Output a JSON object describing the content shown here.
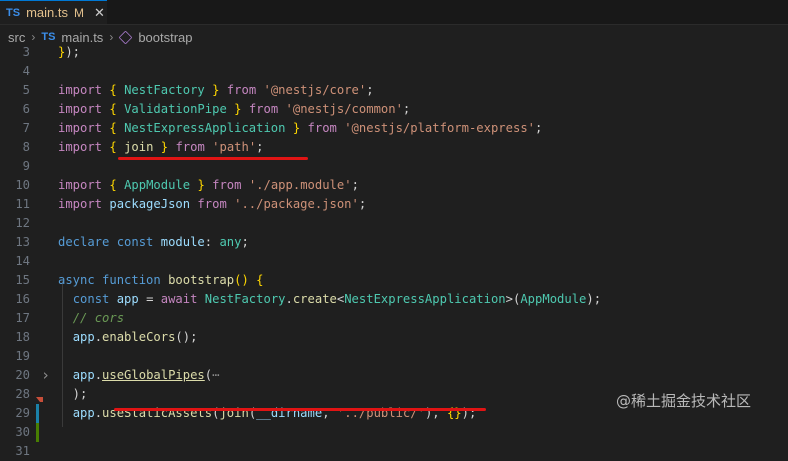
{
  "tab": {
    "icon": "TS",
    "name": "main.ts",
    "status": "M",
    "close": "✕"
  },
  "breadcrumb": {
    "folder": "src",
    "file_icon": "TS",
    "file": "main.ts",
    "symbol": "bootstrap"
  },
  "lines": [
    {
      "n": "3",
      "segs": [
        [
          "br",
          "}"
        ],
        [
          "pl",
          ");"
        ]
      ]
    },
    {
      "n": "4",
      "segs": []
    },
    {
      "n": "5",
      "segs": [
        [
          "kw2",
          "import "
        ],
        [
          "br",
          "{ "
        ],
        [
          "cls",
          "NestFactory"
        ],
        [
          "br",
          " }"
        ],
        [
          "kw2",
          " from "
        ],
        [
          "str",
          "'@nestjs/core'"
        ],
        [
          "pl",
          ";"
        ]
      ]
    },
    {
      "n": "6",
      "segs": [
        [
          "kw2",
          "import "
        ],
        [
          "br",
          "{ "
        ],
        [
          "cls",
          "ValidationPipe"
        ],
        [
          "br",
          " }"
        ],
        [
          "kw2",
          " from "
        ],
        [
          "str",
          "'@nestjs/common'"
        ],
        [
          "pl",
          ";"
        ]
      ]
    },
    {
      "n": "7",
      "segs": [
        [
          "kw2",
          "import "
        ],
        [
          "br",
          "{ "
        ],
        [
          "cls",
          "NestExpressApplication"
        ],
        [
          "br",
          " }"
        ],
        [
          "kw2",
          " from "
        ],
        [
          "str",
          "'@nestjs/platform-express'"
        ],
        [
          "pl",
          ";"
        ]
      ]
    },
    {
      "n": "8",
      "segs": [
        [
          "kw2",
          "import "
        ],
        [
          "br",
          "{ "
        ],
        [
          "fn",
          "join"
        ],
        [
          "br",
          " }"
        ],
        [
          "kw2",
          " from "
        ],
        [
          "str",
          "'path'"
        ],
        [
          "pl",
          ";"
        ]
      ]
    },
    {
      "n": "9",
      "segs": []
    },
    {
      "n": "10",
      "segs": [
        [
          "kw2",
          "import "
        ],
        [
          "br",
          "{ "
        ],
        [
          "cls",
          "AppModule"
        ],
        [
          "br",
          " }"
        ],
        [
          "kw2",
          " from "
        ],
        [
          "str",
          "'./app.module'"
        ],
        [
          "pl",
          ";"
        ]
      ]
    },
    {
      "n": "11",
      "segs": [
        [
          "kw2",
          "import "
        ],
        [
          "var",
          "packageJson"
        ],
        [
          "kw2",
          " from "
        ],
        [
          "str",
          "'../package.json'"
        ],
        [
          "pl",
          ";"
        ]
      ]
    },
    {
      "n": "12",
      "segs": []
    },
    {
      "n": "13",
      "segs": [
        [
          "kw",
          "declare const "
        ],
        [
          "var",
          "module"
        ],
        [
          "pl",
          ": "
        ],
        [
          "cls",
          "any"
        ],
        [
          "pl",
          ";"
        ]
      ]
    },
    {
      "n": "14",
      "segs": []
    },
    {
      "n": "15",
      "segs": [
        [
          "kw",
          "async function "
        ],
        [
          "fn",
          "bootstrap"
        ],
        [
          "br",
          "() {"
        ]
      ]
    },
    {
      "n": "16",
      "segs": [
        [
          "pl",
          "  "
        ],
        [
          "kw",
          "const "
        ],
        [
          "var",
          "app"
        ],
        [
          "pl",
          " = "
        ],
        [
          "kw2",
          "await "
        ],
        [
          "cls",
          "NestFactory"
        ],
        [
          "pl",
          "."
        ],
        [
          "fn",
          "create"
        ],
        [
          "pl",
          "<"
        ],
        [
          "cls",
          "NestExpressApplication"
        ],
        [
          "pl",
          ">("
        ],
        [
          "cls",
          "AppModule"
        ],
        [
          "pl",
          ");"
        ]
      ]
    },
    {
      "n": "17",
      "segs": [
        [
          "pl",
          "  "
        ],
        [
          "cmt",
          "// cors"
        ]
      ]
    },
    {
      "n": "18",
      "segs": [
        [
          "pl",
          "  "
        ],
        [
          "var",
          "app"
        ],
        [
          "pl",
          "."
        ],
        [
          "fn",
          "enableCors"
        ],
        [
          "pl",
          "();"
        ]
      ]
    },
    {
      "n": "19",
      "segs": []
    },
    {
      "n": "20",
      "segs": [
        [
          "pl",
          "  "
        ],
        [
          "var",
          "app"
        ],
        [
          "pl",
          "."
        ],
        [
          "fn underline",
          "useGlobalPipes"
        ],
        [
          "pl",
          "("
        ],
        [
          "dim",
          "⋯"
        ]
      ]
    },
    {
      "n": "28",
      "segs": [
        [
          "pl",
          "  );"
        ]
      ]
    },
    {
      "n": "29",
      "segs": [
        [
          "pl",
          "  "
        ],
        [
          "var",
          "app"
        ],
        [
          "pl",
          "."
        ],
        [
          "fn",
          "useStaticAssets"
        ],
        [
          "pl",
          "("
        ],
        [
          "fn",
          "join"
        ],
        [
          "pl",
          "("
        ],
        [
          "var",
          "__dirname"
        ],
        [
          "pl",
          ", "
        ],
        [
          "str",
          "'../public/'"
        ],
        [
          "pl",
          "), "
        ],
        [
          "br",
          "{}"
        ],
        [
          "pl",
          ");"
        ]
      ]
    },
    {
      "n": "30",
      "segs": []
    },
    {
      "n": "31",
      "segs": []
    }
  ],
  "colors": {
    "git_modified": "#1b81a8",
    "git_added": "#487e02",
    "git_deleted": "#c74e39",
    "annotation": "#e01414"
  },
  "watermark": "@稀土掘金技术社区"
}
